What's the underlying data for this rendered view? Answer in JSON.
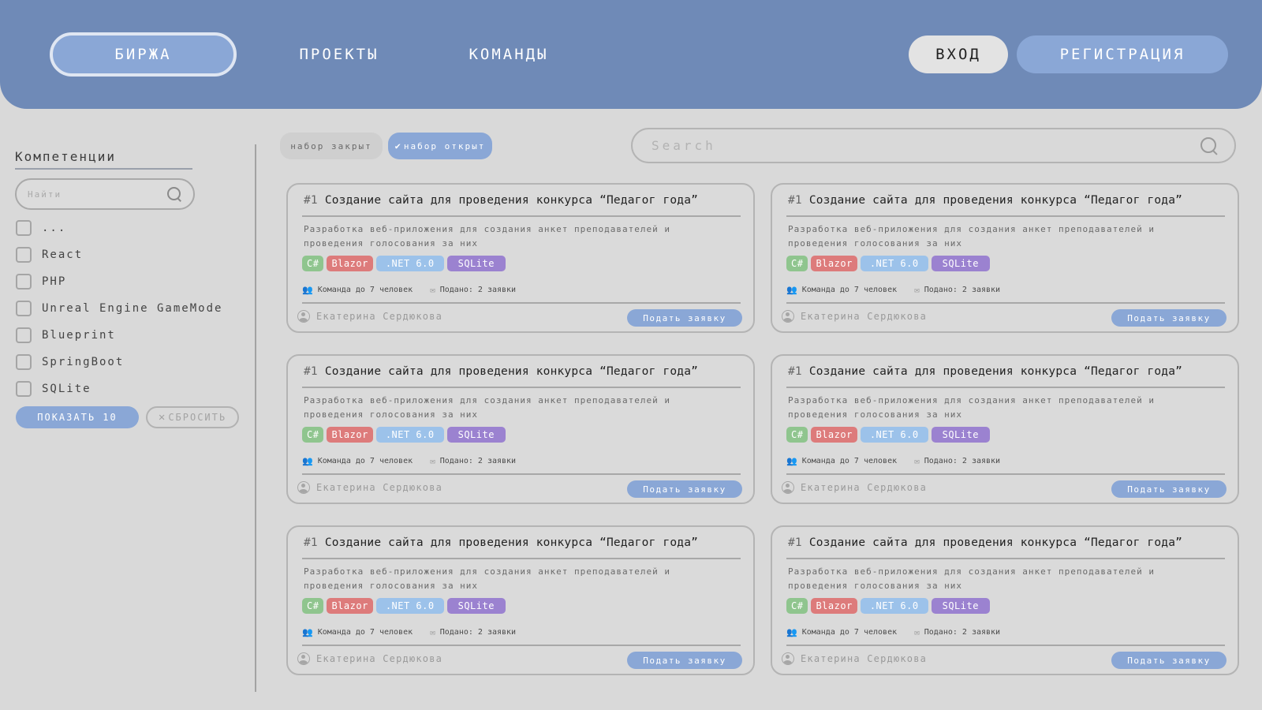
{
  "nav": {
    "birzha": "БИРЖА",
    "proekty": "ПРОЕКТЫ",
    "komandy": "КОМАНДЫ",
    "login": "ВХОД",
    "register": "РЕГИСТРАЦИЯ"
  },
  "sidebar": {
    "title": "Компетенции",
    "search_placeholder": "Найти",
    "items": [
      {
        "label": "..."
      },
      {
        "label": "React"
      },
      {
        "label": "PHP"
      },
      {
        "label": "Unreal Engine GameMode"
      },
      {
        "label": "Blueprint"
      },
      {
        "label": "SpringBoot"
      },
      {
        "label": "SQLite"
      }
    ],
    "show_label": "ПОКАЗАТЬ 10",
    "reset_label": "СБРОСИТЬ"
  },
  "filters": {
    "closed": "набор закрыт",
    "open": "набор открыт"
  },
  "search": {
    "placeholder": "Search"
  },
  "cards": [
    {
      "num": "#1",
      "title": "Создание сайта для проведения конкурса “Педагог года”",
      "desc": "Разработка веб-приложения для создания анкет преподавателей и проведения голосования за них",
      "tags": [
        "C#",
        "Blazor",
        ".NET 6.0",
        "SQLite"
      ],
      "team": "Команда до 7 человек",
      "applied": "Подано: 2 заявки",
      "author": "Екатерина Сердюкова",
      "apply": "Подать заявку"
    },
    {
      "num": "#1",
      "title": "Создание сайта для проведения конкурса “Педагог года”",
      "desc": "Разработка веб-приложения для создания анкет преподавателей и проведения голосования за них",
      "tags": [
        "C#",
        "Blazor",
        ".NET 6.0",
        "SQLite"
      ],
      "team": "Команда до 7 человек",
      "applied": "Подано: 2 заявки",
      "author": "Екатерина Сердюкова",
      "apply": "Подать заявку"
    },
    {
      "num": "#1",
      "title": "Создание сайта для проведения конкурса “Педагог года”",
      "desc": "Разработка веб-приложения для создания анкет преподавателей и проведения голосования за них",
      "tags": [
        "C#",
        "Blazor",
        ".NET 6.0",
        "SQLite"
      ],
      "team": "Команда до 7 человек",
      "applied": "Подано: 2 заявки",
      "author": "Екатерина Сердюкова",
      "apply": "Подать заявку"
    },
    {
      "num": "#1",
      "title": "Создание сайта для проведения конкурса “Педагог года”",
      "desc": "Разработка веб-приложения для создания анкет преподавателей и проведения голосования за них",
      "tags": [
        "C#",
        "Blazor",
        ".NET 6.0",
        "SQLite"
      ],
      "team": "Команда до 7 человек",
      "applied": "Подано: 2 заявки",
      "author": "Екатерина Сердюкова",
      "apply": "Подать заявку"
    },
    {
      "num": "#1",
      "title": "Создание сайта для проведения конкурса “Педагог года”",
      "desc": "Разработка веб-приложения для создания анкет преподавателей и проведения голосования за них",
      "tags": [
        "C#",
        "Blazor",
        ".NET 6.0",
        "SQLite"
      ],
      "team": "Команда до 7 человек",
      "applied": "Подано: 2 заявки",
      "author": "Екатерина Сердюкова",
      "apply": "Подать заявку"
    },
    {
      "num": "#1",
      "title": "Создание сайта для проведения конкурса “Педагог года”",
      "desc": "Разработка веб-приложения для создания анкет преподавателей и проведения голосования за них",
      "tags": [
        "C#",
        "Blazor",
        ".NET 6.0",
        "SQLite"
      ],
      "team": "Команда до 7 человек",
      "applied": "Подано: 2 заявки",
      "author": "Екатерина Сердюкова",
      "apply": "Подать заявку"
    }
  ],
  "colors": {
    "header": "#6f8ab7",
    "accent": "#8aa7d6",
    "background": "#d9d9d9",
    "tag_csharp": "#8fc58e",
    "tag_blazor": "#dd7b7b",
    "tag_net": "#9cc2ea",
    "tag_sqlite": "#9b82d0"
  },
  "icons": {
    "search": "search-icon",
    "team": "team-icon",
    "mail": "mail-icon",
    "user": "user-icon",
    "check": "check-icon",
    "close": "close-icon"
  }
}
